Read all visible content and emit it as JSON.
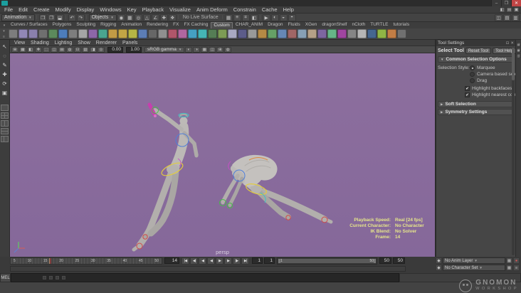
{
  "colors": {
    "viewport_bg": "#8d6f9e",
    "viewport_bg2": "#85689a",
    "hud_text": "#e6e68a",
    "close_red": "#c04545",
    "maya_teal": "#1b9e9e"
  },
  "icons": {
    "expanded_arrow": "▼",
    "collapsed_arrow": "▶",
    "caret_down": "▼",
    "shelf_menu_arrow": "▾",
    "shelf_menu_bars": "≡"
  },
  "titlebar": {
    "window_icons": [
      {
        "name": "minimize-icon",
        "glyph": "–"
      },
      {
        "name": "restore-icon",
        "glyph": "❐"
      },
      {
        "name": "close-icon",
        "glyph": "✕"
      }
    ]
  },
  "menubar": {
    "items": [
      "File",
      "Edit",
      "Create",
      "Modify",
      "Display",
      "Windows",
      "Key",
      "Playback",
      "Visualize",
      "Anim Deform",
      "Constrain",
      "Cache",
      "Help"
    ],
    "right_icons": [
      "◧",
      "▤",
      "▣"
    ]
  },
  "statusline": {
    "menuset": "Animation",
    "selection_mask": "Objects",
    "live_surface": "No Live Surface",
    "file_icons": [
      "❒",
      "❐",
      "⬓"
    ],
    "undo_icons": [
      "↶",
      "↷"
    ],
    "snap_icons": [
      "◉",
      "▦",
      "◎",
      "△",
      "∠",
      "✚",
      "❖"
    ],
    "history_icons": [
      "▦",
      "≡",
      "⌗",
      "◧"
    ],
    "render_icons": [
      "▶",
      "◐",
      "◒",
      "◓"
    ],
    "sidebar_icons": [
      "◫",
      "▤",
      "▥"
    ]
  },
  "shelf": {
    "tabs": [
      "Curves / Surfaces",
      "Polygons",
      "Sculpting",
      "Rigging",
      "Animation",
      "Rendering",
      "FX",
      "FX Caching",
      "Custom",
      "CHAR_ANIM",
      "Dragon",
      "Fluids",
      "XGen",
      "dragonShelf",
      "nCloth",
      "TURTLE",
      "tutorials"
    ],
    "active_tab": "Custom",
    "icon_colors": [
      "#7d7d7d",
      "#9187b5",
      "#8a80ad",
      "#6f6f6f",
      "#5c8a5c",
      "#4d7dbb",
      "#7d7d7d",
      "#a5a5a5",
      "#8d66a8",
      "#4aa58f",
      "#c29b45",
      "#c2a545",
      "#b5b545",
      "#5c7db5",
      "#666666",
      "#8f8f8f",
      "#b0566a",
      "#b066a0",
      "#45a0c2",
      "#45b5b5",
      "#557d55",
      "#7d9b55",
      "#a8a8c2",
      "#5c5c8a",
      "#999999",
      "#b58a45",
      "#66a066",
      "#6687b5",
      "#a06666",
      "#87a0b5",
      "#b5a087",
      "#7d66a0",
      "#66b587",
      "#a045a0",
      "#858585",
      "#b5b5b5",
      "#456690",
      "#90b545",
      "#c27d45",
      "#707070"
    ]
  },
  "toolbox": {
    "tools": [
      {
        "name": "select-tool-icon",
        "glyph": "↖"
      },
      {
        "name": "lasso-tool-icon",
        "glyph": "◌"
      },
      {
        "name": "paint-select-tool-icon",
        "glyph": "✎"
      },
      {
        "name": "move-tool-icon",
        "glyph": "✚"
      },
      {
        "name": "rotate-tool-icon",
        "glyph": "⟳"
      },
      {
        "name": "scale-tool-icon",
        "glyph": "▣"
      }
    ]
  },
  "viewport": {
    "panel_menus": [
      "View",
      "Shading",
      "Lighting",
      "Show",
      "Renderer",
      "Panels"
    ],
    "toolbar_icons_a": [
      "⊞",
      "▦",
      "◧",
      "❖",
      "⬚",
      "◫",
      "▤",
      "◍",
      "⊡",
      "▧",
      "◨",
      "◎"
    ],
    "toolbar_icons_b": [
      "◐",
      "◑",
      "▦",
      "◫",
      "⊞",
      "◍"
    ],
    "field_a": "0.00",
    "field_b": "1.00",
    "gamma": "sRGB gamma",
    "camera_label": "persp",
    "hud": [
      {
        "label": "Playback Speed:",
        "value": "Real [24 fps]"
      },
      {
        "label": "Current Character:",
        "value": "No Character"
      },
      {
        "label": "IK Blend:",
        "value": "No Solver"
      },
      {
        "label": "Frame:",
        "value": "14"
      }
    ]
  },
  "tool_settings": {
    "panel_title": "Tool Settings",
    "header_icons": [
      "⊡",
      "✕"
    ],
    "tool_name": "Select Tool",
    "reset_button": "Reset Tool",
    "help_button": "Tool Help",
    "common_section": "Common Selection Options",
    "selection_style_label": "Selection Style:",
    "style_options": [
      {
        "label": "Marquee",
        "selected": true
      },
      {
        "label": "Camera based select...",
        "selected": false
      },
      {
        "label": "Drag",
        "selected": false
      }
    ],
    "checkboxes": [
      {
        "label": "Highlight backfaces",
        "checked": true
      },
      {
        "label": "Highlight nearest compo...",
        "checked": true
      }
    ],
    "soft_section": "Soft Selection",
    "symmetry_section": "Symmetry Settings"
  },
  "right_strip": {
    "icons": [
      "▤",
      "▦",
      "◫"
    ]
  },
  "timeline": {
    "ticks": [
      "5",
      "10",
      "15",
      "20",
      "25",
      "30",
      "35",
      "40",
      "45",
      "50"
    ],
    "current_frame": "14",
    "transport": [
      {
        "name": "go-to-start-button",
        "glyph": "|◀"
      },
      {
        "name": "step-back-key-button",
        "glyph": "◀|"
      },
      {
        "name": "step-back-frame-button",
        "glyph": "◀"
      },
      {
        "name": "play-backward-button",
        "glyph": "◀"
      },
      {
        "name": "play-forward-button",
        "glyph": "▶"
      },
      {
        "name": "step-forward-frame-button",
        "glyph": "▶"
      },
      {
        "name": "step-forward-key-button",
        "glyph": "|▶"
      },
      {
        "name": "go-to-end-button",
        "glyph": "▶|"
      }
    ],
    "range_start_outer": "1",
    "range_start_inner": "1",
    "range_end_inner": "50",
    "range_end_outer": "50",
    "range_bar_start": "1",
    "range_bar_end": "50",
    "layer_rows": [
      {
        "icon": "◆",
        "label": "No Anim Layer",
        "buttons": [
          "▦",
          "●"
        ]
      },
      {
        "icon": "◆",
        "label": "No Character Set",
        "buttons": [
          "▦",
          "≡"
        ]
      }
    ]
  },
  "command_line": {
    "label": "MEL"
  },
  "watermark": {
    "line1": "GNOMON",
    "line2": "WORKSHOP"
  }
}
